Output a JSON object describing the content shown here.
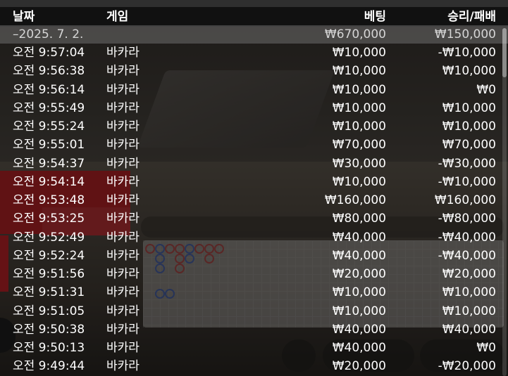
{
  "history": {
    "columns": {
      "date": "날짜",
      "game": "게임",
      "bet": "베팅",
      "result": "승리/패배"
    },
    "date_group": {
      "date": "–2025. 7. 2.",
      "bet_total": "₩670,000",
      "result_total": "₩150,000"
    },
    "rows": [
      {
        "time": "오전 9:57:04",
        "game": "바카라",
        "bet": "₩10,000",
        "result": "-₩10,000"
      },
      {
        "time": "오전 9:56:38",
        "game": "바카라",
        "bet": "₩10,000",
        "result": "₩10,000"
      },
      {
        "time": "오전 9:56:14",
        "game": "바카라",
        "bet": "₩10,000",
        "result": "₩0"
      },
      {
        "time": "오전 9:55:49",
        "game": "바카라",
        "bet": "₩10,000",
        "result": "₩10,000"
      },
      {
        "time": "오전 9:55:24",
        "game": "바카라",
        "bet": "₩10,000",
        "result": "₩10,000"
      },
      {
        "time": "오전 9:55:01",
        "game": "바카라",
        "bet": "₩70,000",
        "result": "₩70,000"
      },
      {
        "time": "오전 9:54:37",
        "game": "바카라",
        "bet": "₩30,000",
        "result": "-₩30,000"
      },
      {
        "time": "오전 9:54:14",
        "game": "바카라",
        "bet": "₩10,000",
        "result": "-₩10,000"
      },
      {
        "time": "오전 9:53:48",
        "game": "바카라",
        "bet": "₩160,000",
        "result": "₩160,000"
      },
      {
        "time": "오전 9:53:25",
        "game": "바카라",
        "bet": "₩80,000",
        "result": "-₩80,000"
      },
      {
        "time": "오전 9:52:49",
        "game": "바카라",
        "bet": "₩40,000",
        "result": "-₩40,000"
      },
      {
        "time": "오전 9:52:24",
        "game": "바카라",
        "bet": "₩40,000",
        "result": "-₩40,000"
      },
      {
        "time": "오전 9:51:56",
        "game": "바카라",
        "bet": "₩20,000",
        "result": "₩20,000"
      },
      {
        "time": "오전 9:51:31",
        "game": "바카라",
        "bet": "₩10,000",
        "result": "₩10,000"
      },
      {
        "time": "오전 9:51:05",
        "game": "바카라",
        "bet": "₩10,000",
        "result": "₩10,000"
      },
      {
        "time": "오전 9:50:38",
        "game": "바카라",
        "bet": "₩40,000",
        "result": "₩40,000"
      },
      {
        "time": "오전 9:50:13",
        "game": "바카라",
        "bet": "₩40,000",
        "result": "₩0"
      },
      {
        "time": "오전 9:49:44",
        "game": "바카라",
        "bet": "₩20,000",
        "result": "-₩20,000"
      }
    ]
  },
  "colors": {
    "overlay": "#000000",
    "text": "#ffffff",
    "date_row": "#6e6e6e",
    "banker": "#c63a3a",
    "player": "#3a5fc6"
  }
}
